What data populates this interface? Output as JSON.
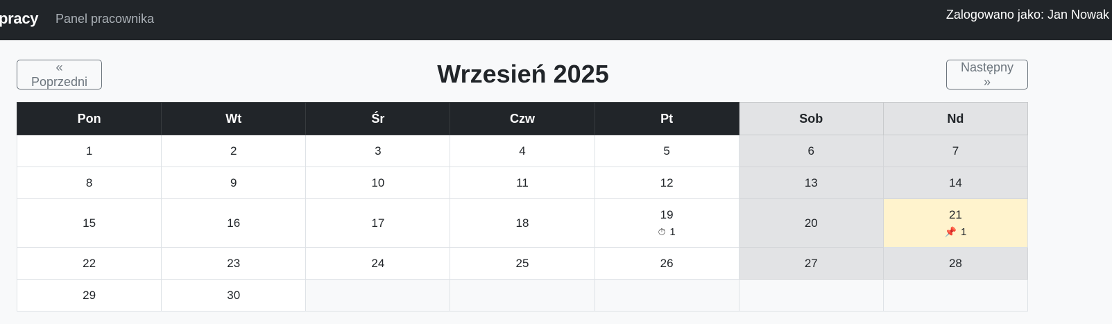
{
  "navbar": {
    "brand": "pracy",
    "link": "Panel pracownika",
    "user": "Zalogowano jako: Jan Nowak"
  },
  "calendar": {
    "prev_label": "« Poprzedni",
    "next_label": "Następny »",
    "title": "Wrzesień 2025",
    "weekdays": [
      "Pon",
      "Wt",
      "Śr",
      "Czw",
      "Pt",
      "Sob",
      "Nd"
    ],
    "weeks": [
      [
        {
          "day": "1"
        },
        {
          "day": "2"
        },
        {
          "day": "3"
        },
        {
          "day": "4"
        },
        {
          "day": "5"
        },
        {
          "day": "6"
        },
        {
          "day": "7"
        }
      ],
      [
        {
          "day": "8"
        },
        {
          "day": "9"
        },
        {
          "day": "10"
        },
        {
          "day": "11"
        },
        {
          "day": "12"
        },
        {
          "day": "13"
        },
        {
          "day": "14"
        }
      ],
      [
        {
          "day": "15"
        },
        {
          "day": "16"
        },
        {
          "day": "17"
        },
        {
          "day": "18"
        },
        {
          "day": "19",
          "badge_icon": "stopwatch-icon",
          "badge_count": "1"
        },
        {
          "day": "20"
        },
        {
          "day": "21",
          "badge_icon": "pushpin-icon",
          "badge_count": "1",
          "highlight": true
        }
      ],
      [
        {
          "day": "22"
        },
        {
          "day": "23"
        },
        {
          "day": "24"
        },
        {
          "day": "25"
        },
        {
          "day": "26"
        },
        {
          "day": "27"
        },
        {
          "day": "28"
        }
      ],
      [
        {
          "day": "29"
        },
        {
          "day": "30"
        },
        {
          "day": ""
        },
        {
          "day": ""
        },
        {
          "day": ""
        },
        {
          "day": ""
        },
        {
          "day": ""
        }
      ]
    ]
  },
  "colors": {
    "navbar_bg": "#212529",
    "weekend_bg": "#e2e3e5",
    "highlight_bg": "#fff3cd"
  }
}
